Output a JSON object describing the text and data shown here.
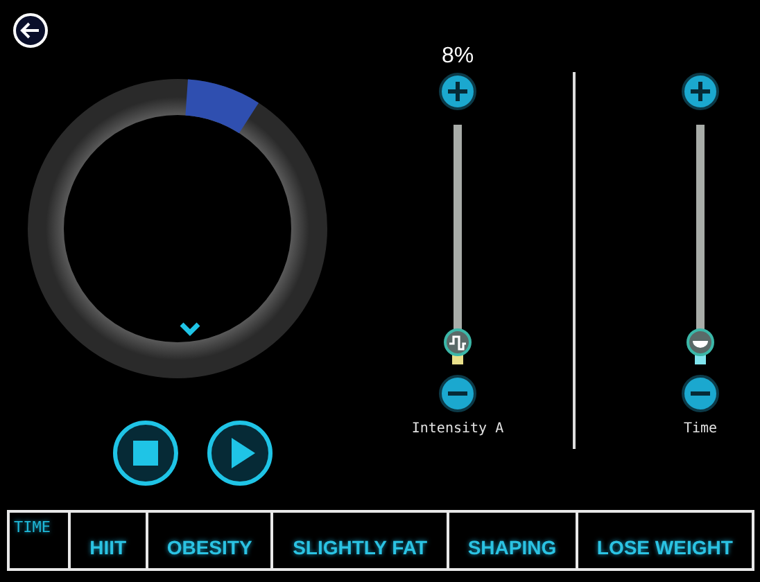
{
  "sliders": [
    {
      "kind": "wave",
      "reading": "8%",
      "label": "Intensity A",
      "level": 0.03
    },
    {
      "kind": "timer",
      "label": "Time",
      "level": 0.03
    }
  ],
  "mode_bar": {
    "caption": "TIME",
    "tabs": [
      {
        "label": "HIIT",
        "selected": false
      },
      {
        "label": "OBESITY",
        "selected": false
      },
      {
        "label": "SLIGHTLY FAT",
        "selected": false
      },
      {
        "label": "SHAPING",
        "selected": false
      },
      {
        "label": "LOSE WEIGHT",
        "selected": false
      }
    ]
  }
}
